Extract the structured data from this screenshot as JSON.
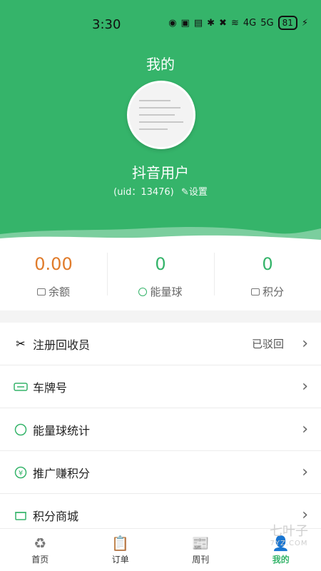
{
  "status_bar": {
    "time": "3:30",
    "battery": "81",
    "signal_1": "4G",
    "signal_2": "5G"
  },
  "header": {
    "title": "我的",
    "username": "抖音用户",
    "uid_text": "(uid：13476)",
    "settings_label": "设置"
  },
  "stats": [
    {
      "value": "0.00",
      "label": "余额",
      "icon": "wallet-icon"
    },
    {
      "value": "0",
      "label": "能量球",
      "icon": "energy-ball-icon"
    },
    {
      "value": "0",
      "label": "积分",
      "icon": "points-icon"
    }
  ],
  "menu": {
    "items": [
      {
        "label": "注册回收员",
        "status": "已驳回",
        "icon": "tools-icon"
      },
      {
        "label": "车牌号",
        "status": "",
        "icon": "license-plate-icon"
      },
      {
        "label": "能量球统计",
        "status": "",
        "icon": "energy-ball-icon"
      },
      {
        "label": "推广赚积分",
        "status": "",
        "icon": "yen-icon"
      },
      {
        "label": "积分商城",
        "status": "",
        "icon": "store-icon"
      }
    ]
  },
  "tabbar": {
    "items": [
      {
        "label": "首页",
        "icon": "recycle-icon",
        "active": false
      },
      {
        "label": "订单",
        "icon": "clipboard-icon",
        "active": false
      },
      {
        "label": "周刊",
        "icon": "newspaper-icon",
        "active": false
      },
      {
        "label": "我的",
        "icon": "user-icon",
        "active": true
      }
    ]
  },
  "watermark": {
    "main": "七叶子",
    "sub": "7YZ.COM"
  },
  "colors": {
    "brand_green": "#35b46a",
    "balance_orange": "#e07b2a"
  }
}
